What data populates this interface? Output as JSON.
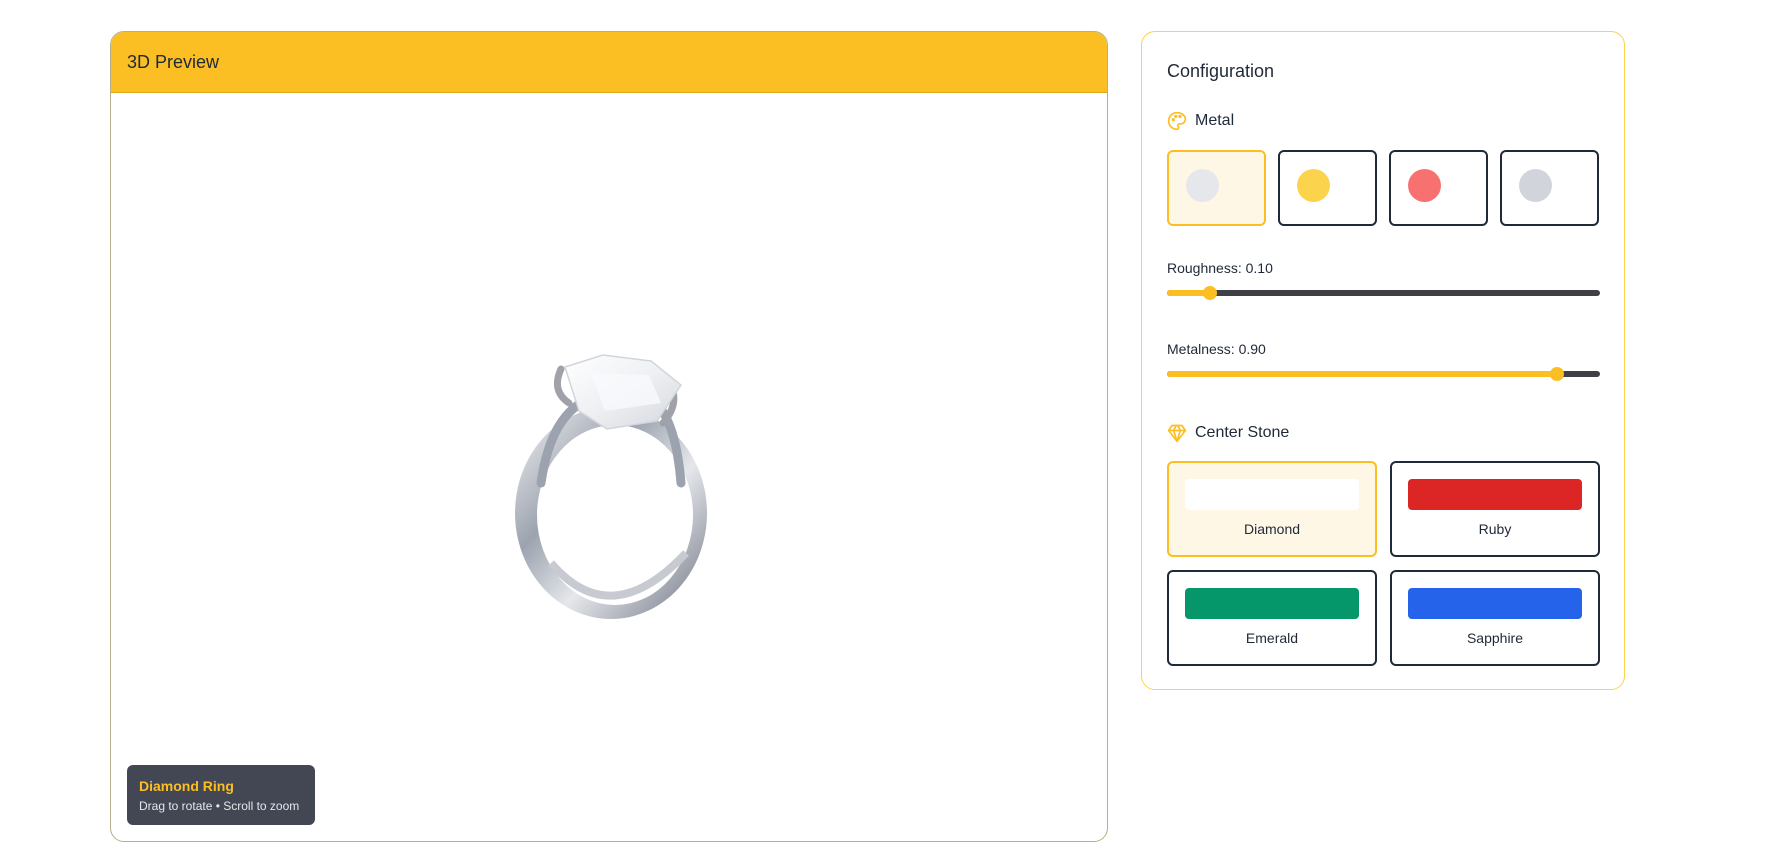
{
  "preview": {
    "title": "3D Preview",
    "info_title": "Diamond Ring",
    "info_hint": "Drag to rotate • Scroll to zoom"
  },
  "config": {
    "title": "Configuration",
    "metal": {
      "label": "Metal",
      "icon": "palette-icon",
      "options": [
        {
          "color": "#e5e7eb",
          "selected": true
        },
        {
          "color": "#fcd34d",
          "selected": false
        },
        {
          "color": "#f87171",
          "selected": false
        },
        {
          "color": "#d1d5db",
          "selected": false
        }
      ]
    },
    "roughness": {
      "label": "Roughness: 0.10",
      "value": 0.1
    },
    "metalness": {
      "label": "Metalness: 0.90",
      "value": 0.9
    },
    "center_stone": {
      "label": "Center Stone",
      "icon": "gem-icon",
      "options": [
        {
          "name": "Diamond",
          "color": "#ffffff",
          "selected": true
        },
        {
          "name": "Ruby",
          "color": "#dc2626",
          "selected": false
        },
        {
          "name": "Emerald",
          "color": "#059669",
          "selected": false
        },
        {
          "name": "Sapphire",
          "color": "#2563eb",
          "selected": false
        }
      ]
    }
  },
  "colors": {
    "accent": "#fbbf24",
    "dark": "#1f2937"
  }
}
